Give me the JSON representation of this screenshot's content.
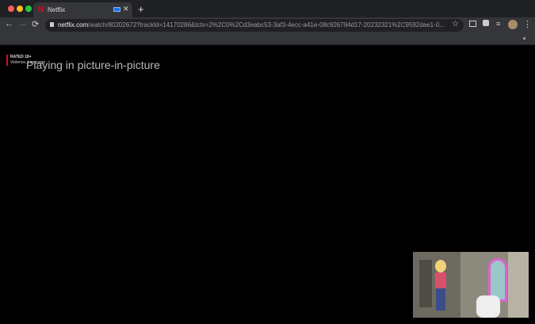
{
  "tab": {
    "title": "Netflix",
    "close": "✕",
    "new_tab": "+"
  },
  "toolbar": {
    "back": "←",
    "forward": "→",
    "reload": "⟳",
    "url_host": "netflix.com",
    "url_path": "/watch/80202672?trackId=14170286&tctx=2%2C0%2Cd3eabc53-3af3-4ecc-a41e-08c926794d17-20232321%2C9592dae1-0...",
    "star": "☆",
    "menu": "⋮"
  },
  "player": {
    "rating": "RATED 18+",
    "advisory": "Violence, Language",
    "pip_message": "Playing in picture-in-picture"
  },
  "colors": {
    "brand": "#e50914"
  }
}
